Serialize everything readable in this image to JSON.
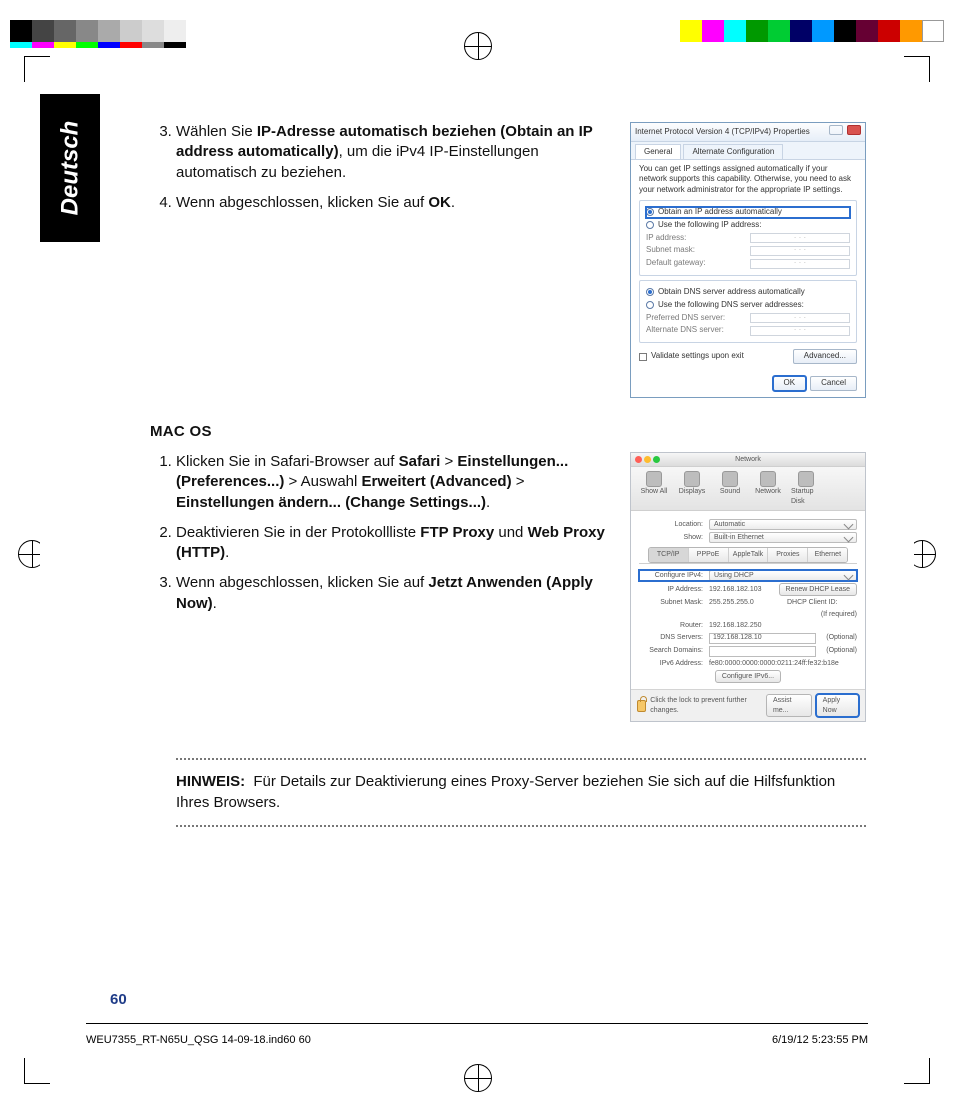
{
  "sidetab": "Deutsch",
  "steps_a": {
    "s3": {
      "pre": "Wählen Sie ",
      "b1": "IP-Adresse automatisch beziehen (Obtain an IP address automatically)",
      "post": ", um die iPv4 IP-Einstellungen automatisch zu beziehen."
    },
    "s4": {
      "pre": "Wenn abgeschlossen, klicken Sie auf ",
      "b1": "OK",
      "post": "."
    }
  },
  "mac_heading": "MAC OS",
  "steps_b": {
    "s1": {
      "pre": "Klicken Sie in Safari-Browser auf ",
      "b1": "Safari",
      "g1": " > ",
      "b2": "Einstellungen... (Preferences...)",
      "g2": " > Auswahl ",
      "b3": "Erweitert (Advanced)",
      "g3": " > ",
      "b4": "Einstellungen ändern... (Change Settings...)",
      "post": "."
    },
    "s2": {
      "pre": "Deaktivieren Sie in der Protokollliste ",
      "b1": "FTP Proxy",
      "mid": " und ",
      "b2": "Web Proxy (HTTP)",
      "post": "."
    },
    "s3": {
      "pre": "Wenn abgeschlossen, klicken Sie auf ",
      "b1": "Jetzt Anwenden (Apply Now)",
      "post": "."
    }
  },
  "note": {
    "label": "HINWEIS:",
    "text": "  Für Details zur Deaktivierung eines Proxy-Server beziehen Sie sich auf die Hilfsfunktion Ihres Browsers."
  },
  "page_number": "60",
  "footer": {
    "left": "WEU7355_RT-N65U_QSG 14-09-18.ind60   60",
    "right": "6/19/12   5:23:55 PM"
  },
  "win": {
    "title": "Internet Protocol Version 4 (TCP/IPv4) Properties",
    "tabs": {
      "t1": "General",
      "t2": "Alternate Configuration"
    },
    "info": "You can get IP settings assigned automatically if your network supports this capability. Otherwise, you need to ask your network administrator for the appropriate IP settings.",
    "opt_auto_ip": "Obtain an IP address automatically",
    "opt_manual_ip": "Use the following IP address:",
    "f_ip": "IP address:",
    "f_mask": "Subnet mask:",
    "f_gw": "Default gateway:",
    "opt_auto_dns": "Obtain DNS server address automatically",
    "opt_manual_dns": "Use the following DNS server addresses:",
    "f_dns1": "Preferred DNS server:",
    "f_dns2": "Alternate DNS server:",
    "chk_validate": "Validate settings upon exit",
    "btn_adv": "Advanced...",
    "btn_ok": "OK",
    "btn_cancel": "Cancel"
  },
  "mac": {
    "title": "Network",
    "tb": {
      "showall": "Show All",
      "displays": "Displays",
      "sound": "Sound",
      "network": "Network",
      "startup": "Startup Disk"
    },
    "loc_label": "Location:",
    "loc_val": "Automatic",
    "show_label": "Show:",
    "show_val": "Built-in Ethernet",
    "tabs": {
      "t1": "TCP/IP",
      "t2": "PPPoE",
      "t3": "AppleTalk",
      "t4": "Proxies",
      "t5": "Ethernet"
    },
    "cfg_label": "Configure IPv4:",
    "cfg_val": "Using DHCP",
    "ip_label": "IP Address:",
    "ip_val": "192.168.182.103",
    "renew": "Renew DHCP Lease",
    "mask_label": "Subnet Mask:",
    "mask_val": "255.255.255.0",
    "client_label": "DHCP Client ID:",
    "client_hint": "(If required)",
    "router_label": "Router:",
    "router_val": "192.168.182.250",
    "dns_label": "DNS Servers:",
    "dns_val": "192.168.128.10",
    "dns_hint": "(Optional)",
    "search_label": "Search Domains:",
    "search_hint": "(Optional)",
    "ipv6_label": "IPv6 Address:",
    "ipv6_val": "fe80:0000:0000:0000:0211:24ff:fe32:b18e",
    "cfgv6": "Configure IPv6...",
    "lock": "Click the lock to prevent further changes.",
    "assist": "Assist me...",
    "apply": "Apply Now"
  },
  "colors": {
    "accent": "#1f3c88",
    "highlight": "#2b6ecf"
  }
}
